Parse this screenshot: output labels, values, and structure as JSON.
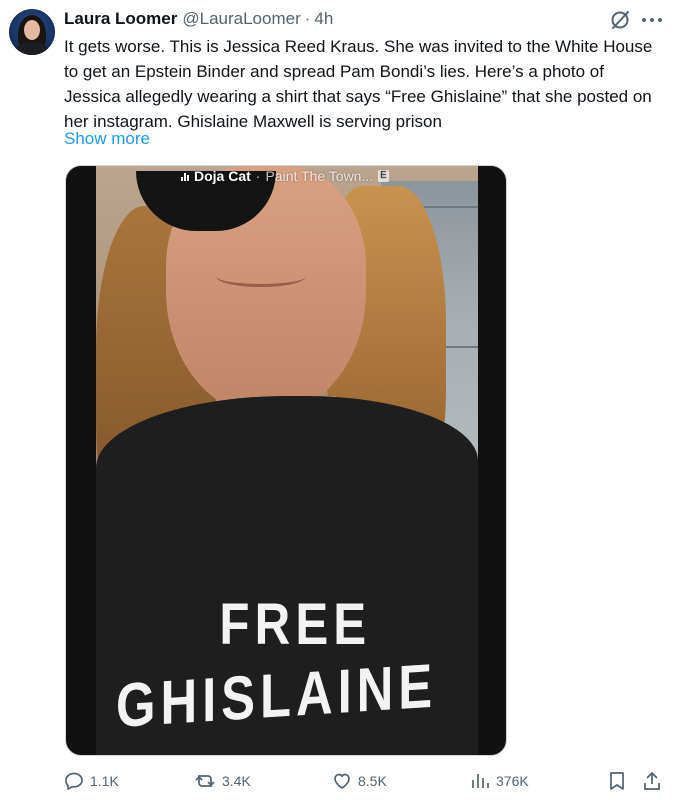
{
  "author": {
    "name": "Laura Loomer",
    "handle": "@LauraLoomer",
    "separator": "·",
    "time": "4h"
  },
  "tweet": {
    "text": "It gets worse. This is Jessica Reed Kraus. She was invited to the White House to get an Epstein Binder and spread Pam Bondi’s lies. Here’s a photo of Jessica allegedly wearing a shirt that says “Free Ghislaine” that she posted on her instagram. Ghislaine Maxwell is serving prison",
    "show_more": "Show more"
  },
  "media": {
    "story_song": "Doja Cat",
    "story_sep": "·",
    "story_track": "Paint The Town...",
    "story_badge": "E",
    "shirt_line1": "FREE",
    "shirt_line2": "GHISLAINE"
  },
  "actions": {
    "replies": "1.1K",
    "reposts": "3.4K",
    "likes": "8.5K",
    "views": "376K"
  },
  "colors": {
    "text": "#0f1419",
    "secondary": "#536471",
    "link": "#1d9bf0"
  }
}
